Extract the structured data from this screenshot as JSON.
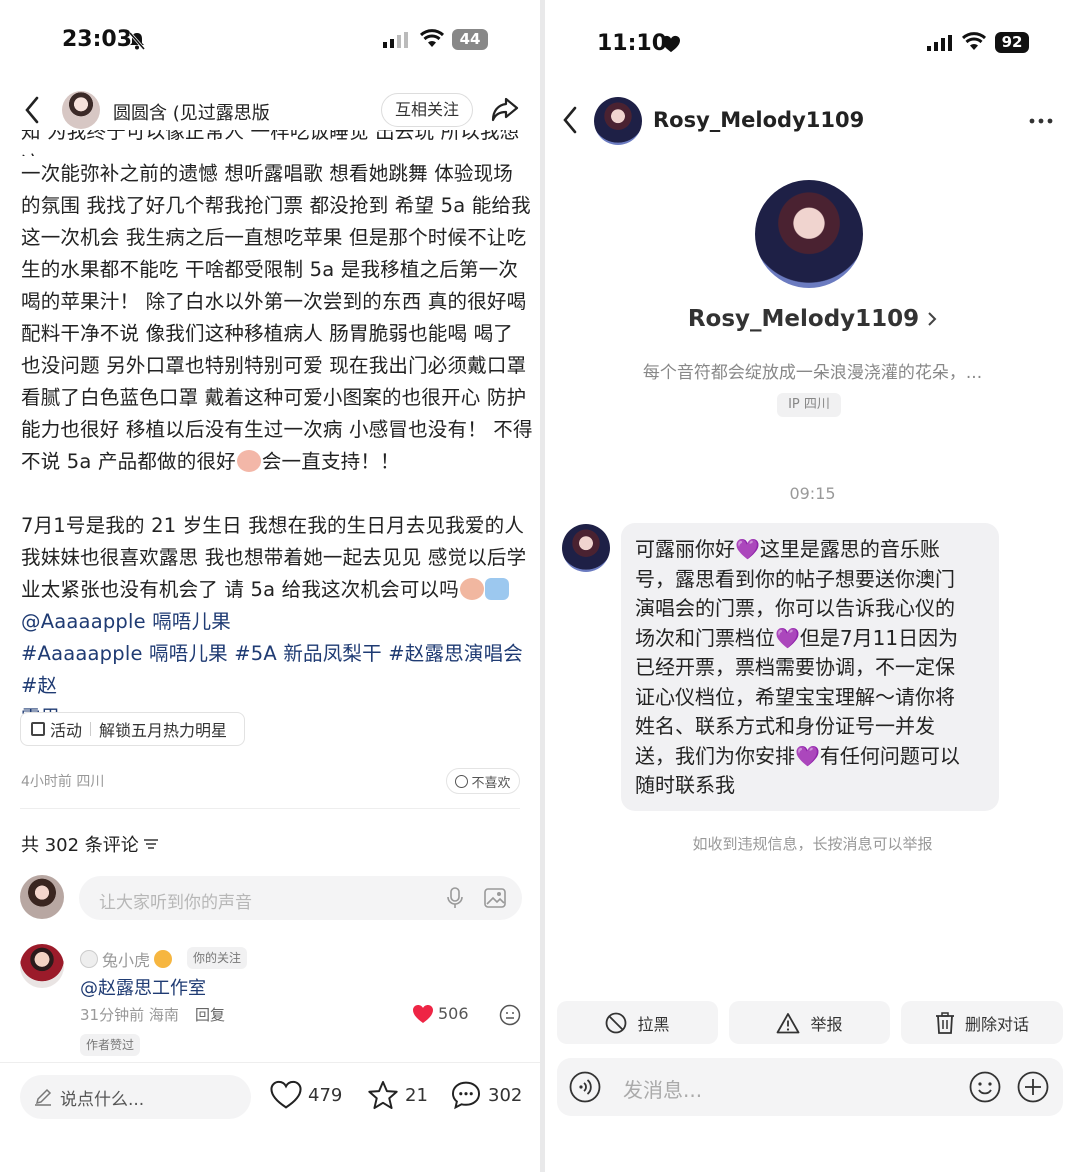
{
  "left": {
    "status": {
      "time": "23:03",
      "battery": "44"
    },
    "header": {
      "username": "圆圆含 (见过露思版",
      "follow_label": "互相关注"
    },
    "post": {
      "cut_line": "知 为我终于可以像正常人 一样吃饭睡觉 出去玩 所以我想这",
      "paragraph1": "一次能弥补之前的遗憾 想听露唱歌 想看她跳舞 体验现场\n的氛围 我找了好几个帮我抢门票 都没抢到 希望 5a 能给我\n这一次机会 我生病之后一直想吃苹果 但是那个时候不让吃\n生的水果都不能吃 干啥都受限制 5a 是我移植之后第一次\n喝的苹果汁！ 除了白水以外第一次尝到的东西 真的很好喝\n配料干净不说 像我们这种移植病人 肠胃脆弱也能喝 喝了\n也没问题 另外口罩也特别特别可爱 现在我出门必须戴口罩\n看腻了白色蓝色口罩 戴着这种可爱小图案的也很开心 防护\n能力也很好 移植以后没有生过一次病 小感冒也没有！ 不得\n不说 5a 产品都做的很好",
      "paragraph1_tail": "会一直支持！！",
      "paragraph2": "7月1号是我的 21 岁生日 我想在我的生日月去见我爱的人\n我妹妹也很喜欢露思 我也想带着她一起去见见 感觉以后学\n业太紧张也没有机会了 请 5a 给我这次机会可以吗",
      "mention": "@Aaaaapple 嗝唔儿果",
      "tags_line1": "#Aaaaapple 嗝唔儿果 #5A 新品凤梨干 #赵露思演唱会 #赵",
      "tags_line2": "露思",
      "activity_label": "活动",
      "activity_name": "解锁五月热力明星",
      "meta": "4小时前 四川",
      "dislike_label": "不喜欢"
    },
    "comments": {
      "count_label": "共 302 条评论",
      "input_placeholder": "让大家听到你的声音",
      "first": {
        "username": "兔小虎",
        "badge": "你的关注",
        "text": "@赵露思工作室",
        "meta": "31分钟前 海南",
        "reply_label": "回复",
        "likes": "506",
        "author_liked": "作者赞过"
      }
    },
    "bottom": {
      "input_placeholder": "说点什么...",
      "likes": "479",
      "stars": "21",
      "comments": "302"
    }
  },
  "right": {
    "status": {
      "time": "11:10",
      "battery": "92"
    },
    "header": {
      "username": "Rosy_Melody1109"
    },
    "profile": {
      "name": "Rosy_Melody1109",
      "bio": "每个音符都会绽放成一朵浪漫浇灌的花朵，...",
      "ip": "IP 四川"
    },
    "chat": {
      "timestamp": "09:15",
      "message_lines": [
        "可露丽你好💜这里是露思的音乐账",
        "号，露思看到你的帖子想要送你澳门",
        "演唱会的门票，你可以告诉我心仪的",
        "场次和门票档位💜但是7月11日因为",
        "已经开票，票档需要协调，不一定保",
        "证心仪档位，希望宝宝理解～请你将",
        "姓名、联系方式和身份证号一并发",
        "送，我们为你安排💜有任何问题可以",
        "随时联系我"
      ],
      "report_hint": "如收到违规信息，长按消息可以举报"
    },
    "actions": {
      "block": "拉黑",
      "report": "举报",
      "delete": "删除对话"
    },
    "input": {
      "placeholder": "发消息..."
    }
  },
  "colors": {
    "heart_red": "#ee2545",
    "tag_blue": "#1f3b73",
    "purple_heart": "#a241e6"
  }
}
